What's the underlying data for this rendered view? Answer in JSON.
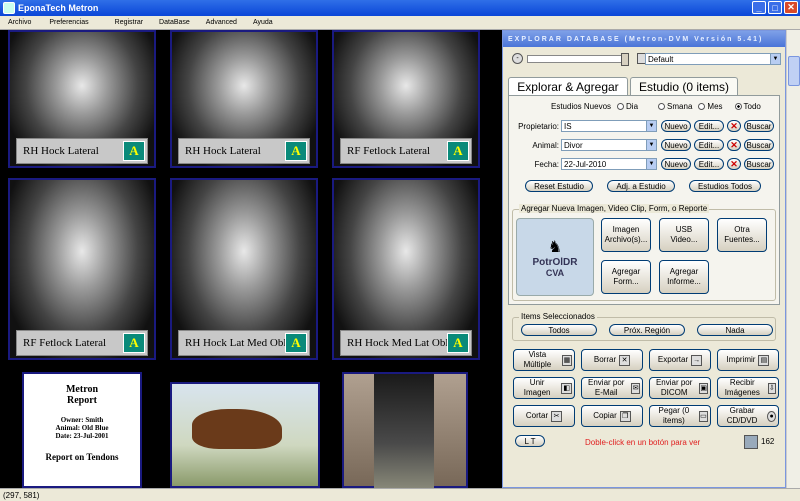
{
  "window": {
    "title": "EponaTech Metron"
  },
  "menu": [
    "Archivo",
    "Preferencias",
    "Registrar",
    "DataBase",
    "Advanced",
    "Ayuda"
  ],
  "tiles": [
    {
      "caption": "RH Hock Lateral"
    },
    {
      "caption": "RH Hock Lateral"
    },
    {
      "caption": "RF Fetlock Lateral"
    },
    {
      "caption": "RF Fetlock Lateral"
    },
    {
      "caption": "RH Hock Lat Med Obl"
    },
    {
      "caption": "RH Hock Med Lat Obl"
    }
  ],
  "report": {
    "title": "Metron",
    "subtitle": "Report",
    "owner": "Owner: Smith",
    "animal": "Animal: Old Blue",
    "date": "Date: 23-Jul-2001",
    "heading": "Report on Tendons"
  },
  "panel": {
    "header": "EXPLORAR DATABASE (Metron-DVM Versión 5.41)",
    "preset": "Default",
    "tabs": [
      "Explorar & Agregar",
      "Estudio (0 items)"
    ],
    "new_studies_label": "Estudios Nuevos",
    "radios": [
      "Dia",
      "Smana",
      "Mes",
      "Todo"
    ],
    "fields": [
      {
        "label": "Propietario:",
        "value": "IS"
      },
      {
        "label": "Animal:",
        "value": "Divor"
      },
      {
        "label": "Fecha:",
        "value": "22-Jul-2010"
      }
    ],
    "field_buttons": {
      "new": "Nuevo",
      "edit": "Edit...",
      "delete": "✕",
      "search": "Buscar"
    },
    "study_buttons": [
      "Reset Estudio",
      "Adj. a Estudio",
      "Estudios Todos"
    ],
    "add_group": "Agregar Nueva Imagen, Video Clip, Form, o Reporte",
    "brand": {
      "name": "PotrOlDR",
      "sub": "CVA"
    },
    "add_buttons": [
      "Imagen Archivo(s)...",
      "USB Video...",
      "Otra Fuentes...",
      "Agregar Form...",
      "Agregar Informe..."
    ],
    "selected_group": "Items Seleccionados",
    "selected_buttons": [
      "Todos",
      "Próx. Región",
      "Nada"
    ],
    "action_buttons": [
      "Vista Múltiple",
      "Borrar",
      "Exportar",
      "Imprimir",
      "Unir Imagen",
      "Enviar por E-Mail",
      "Enviar por DICOM",
      "Recibir Imágenes",
      "Cortar",
      "Copiar",
      "Pegar (0 items)",
      "Grabar CD/DVD"
    ],
    "lt_label": "L T",
    "hint": "Doble-click en un botón para ver",
    "count": "162"
  },
  "status": {
    "coords": "(297, 581)"
  }
}
